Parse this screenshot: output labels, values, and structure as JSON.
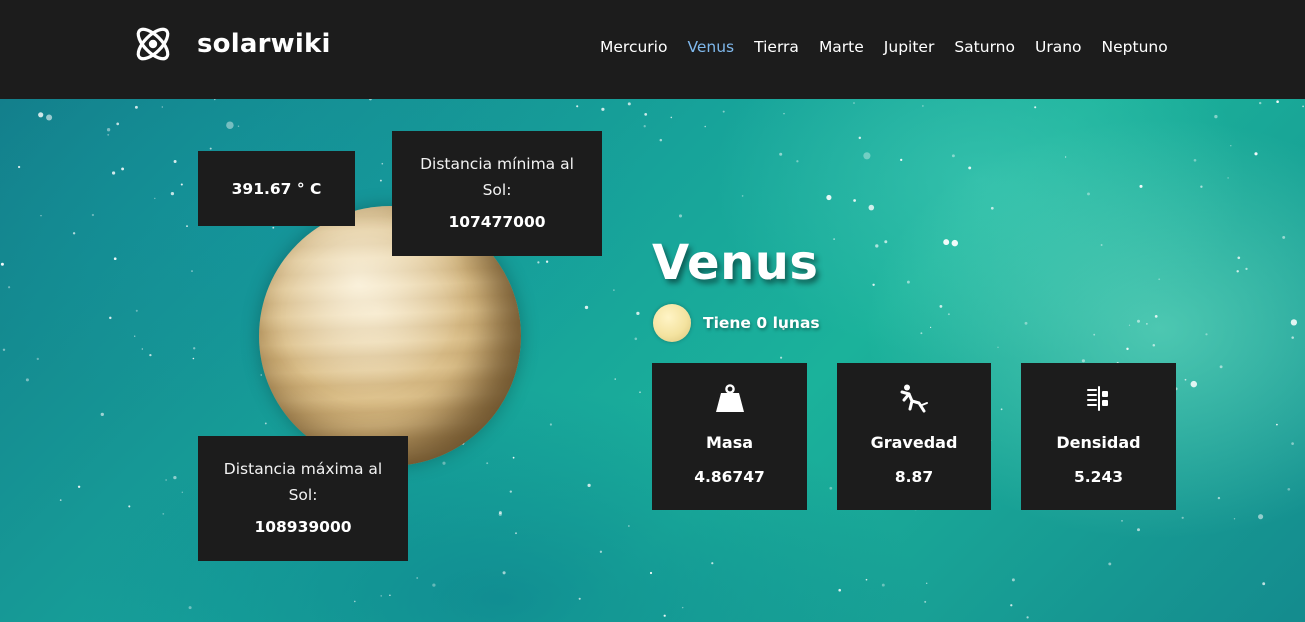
{
  "header": {
    "logo_text": "solarwiki",
    "nav": [
      {
        "label": "Mercurio",
        "active": false
      },
      {
        "label": "Venus",
        "active": true
      },
      {
        "label": "Tierra",
        "active": false
      },
      {
        "label": "Marte",
        "active": false
      },
      {
        "label": "Jupiter",
        "active": false
      },
      {
        "label": "Saturno",
        "active": false
      },
      {
        "label": "Urano",
        "active": false
      },
      {
        "label": "Neptuno",
        "active": false
      }
    ]
  },
  "info": {
    "temperature": "391.67 ° C",
    "min_distance_label": "Distancia mínima al Sol:",
    "min_distance_value": "107477000",
    "max_distance_label": "Distancia máxima al Sol:",
    "max_distance_value": "108939000"
  },
  "planet": {
    "name": "Venus",
    "moons_prefix": "Tiene",
    "moons_count": "0",
    "moons_suffix": "lunas"
  },
  "stats": [
    {
      "label": "Masa",
      "value": "4.86747",
      "icon": "weight-icon"
    },
    {
      "label": "Gravedad",
      "value": "8.87",
      "icon": "falling-person-icon"
    },
    {
      "label": "Densidad",
      "value": "5.243",
      "icon": "density-icon"
    }
  ],
  "colors": {
    "header_bg": "#1c1c1c",
    "nav_active": "#7fb8ec",
    "card_bg": "#1c1c1c"
  }
}
